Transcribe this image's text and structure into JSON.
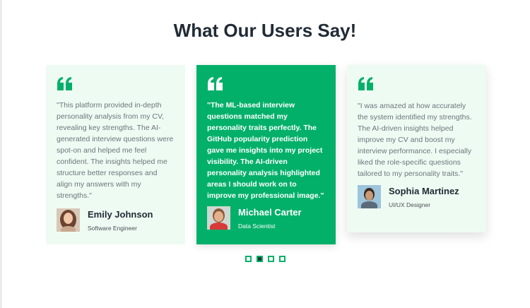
{
  "page": {
    "title": "What Our Users Say!"
  },
  "colors": {
    "accent": "#03b06a",
    "card_bg": "#eefbf2",
    "heading": "#212b36"
  },
  "testimonials": [
    {
      "quote": "\"This platform provided in-depth personality analysis from my CV, revealing key strengths. The AI-generated interview questions were spot-on and helped me feel confident. The insights helped me structure better responses and align my answers with my strengths.\"",
      "name": "Emily Johnson",
      "role": "Software Engineer",
      "highlighted": false
    },
    {
      "quote": "\"The ML-based interview questions matched my personality traits perfectly. The GitHub popularity prediction gave me insights into my project visibility. The AI-driven personality analysis highlighted areas I should work on to improve my professional image.\"",
      "name": "Michael Carter",
      "role": "Data Scientist",
      "highlighted": true
    },
    {
      "quote": "\"I was amazed at how accurately the system identified my strengths. The AI-driven insights helped improve my CV and boost my interview performance. I especially liked the role-specific questions tailored to my personality traits.\"",
      "name": "Sophia Martinez",
      "role": "UI/UX Designer",
      "highlighted": false
    }
  ],
  "carousel": {
    "total_dots": 4,
    "active_index": 1
  }
}
